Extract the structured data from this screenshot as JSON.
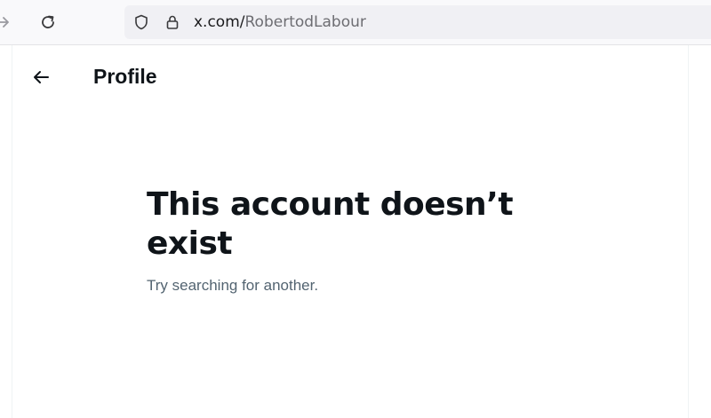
{
  "browser": {
    "url_domain": "x.com/",
    "url_path": "RobertodLabour",
    "icons": {
      "forward": "arrow-right-icon",
      "reload": "reload-icon",
      "shield": "shield-icon",
      "lock": "lock-icon"
    }
  },
  "header": {
    "back_icon": "arrow-left-icon",
    "title": "Profile"
  },
  "empty_state": {
    "title": "This account doesn’t exist",
    "subtitle": "Try searching for another."
  },
  "colors": {
    "text_primary": "#0f1419",
    "text_secondary": "#536471",
    "divider": "#eff3f4"
  }
}
